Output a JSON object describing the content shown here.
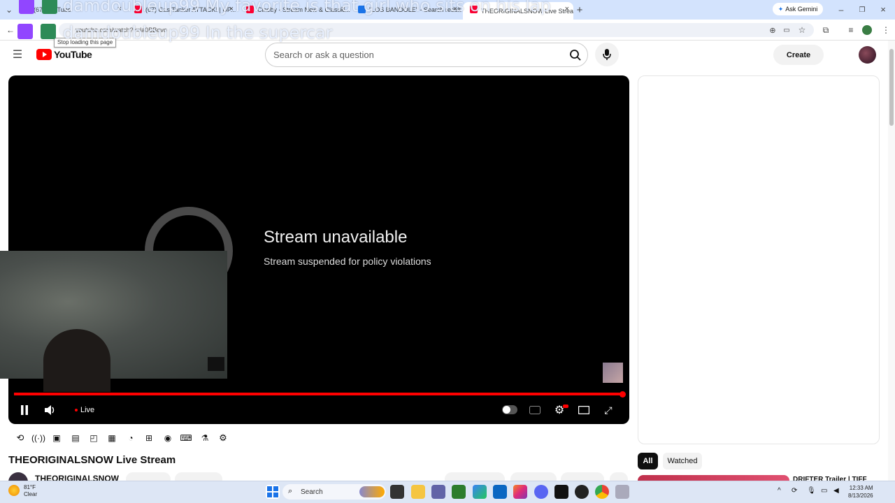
{
  "browser": {
    "tabs": [
      {
        "label": "(67) YouTube"
      },
      {
        "label": "(67) Gas Tanker ATTACK! | UP..."
      },
      {
        "label": "Cineby - Stream New & Classic..."
      },
      {
        "label": "\"LOS BANDOLE\" - Search result..."
      },
      {
        "label": "THEORIGINALSNOW Live Strea..."
      }
    ],
    "ask_gemini": "Ask Gemini",
    "url": "youtube.com/watch?v=la0BBqvo",
    "tooltip": "Stop loading this page"
  },
  "chat_overlay": [
    {
      "user": "damdoubleup99",
      "message": "My favorite is that girl who sits on his lap"
    },
    {
      "user": "damdoubleup99",
      "message": "In the supercar"
    }
  ],
  "youtube": {
    "logo_text": "YouTube",
    "search_placeholder": "Search or ask a question",
    "create_label": "Create"
  },
  "player": {
    "error_title": "Stream unavailable",
    "error_subtitle": "Stream suspended for policy violations",
    "live_label": "Live",
    "progress": 1.0
  },
  "video": {
    "title": "THEORIGINALSNOW Live Stream",
    "channel": "THEORIGINALSNOW"
  },
  "sidebar": {
    "chips": [
      "All",
      "Watched"
    ],
    "recommendation_title": "DRIFTER Trailer | TIFF"
  },
  "taskbar": {
    "weather_temp": "81°F",
    "weather_desc": "Clear",
    "search_label": "Search",
    "time": "12:33 AM",
    "date": "8/13/2026"
  },
  "colors": {
    "accent_red": "#ff0000",
    "tab_strip": "#d3e3fd",
    "player_bg": "#000000"
  }
}
